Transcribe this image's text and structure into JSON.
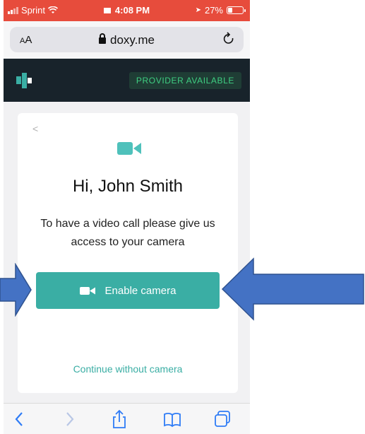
{
  "status_bar": {
    "carrier": "Sprint",
    "time": "4:08 PM",
    "battery": "27%"
  },
  "address_bar": {
    "text_size_label_big": "A",
    "text_size_label_small": "A",
    "url": "doxy.me"
  },
  "header": {
    "status_badge": "PROVIDER AVAILABLE"
  },
  "card": {
    "greeting": "Hi, John Smith",
    "message": "To have a video call please give us access to your camera",
    "enable_button": "Enable camera",
    "continue_link": "Continue without camera"
  },
  "icons": {
    "back": "chevron-left-icon",
    "forward": "chevron-right-icon",
    "share": "share-icon",
    "bookmarks": "book-icon",
    "tabs": "tabs-icon"
  },
  "colors": {
    "status_bar": "#e74c3c",
    "app_header": "#18232b",
    "brand_teal": "#3aaea4",
    "badge_text": "#3fcf82",
    "arrow": "#4472c4"
  }
}
